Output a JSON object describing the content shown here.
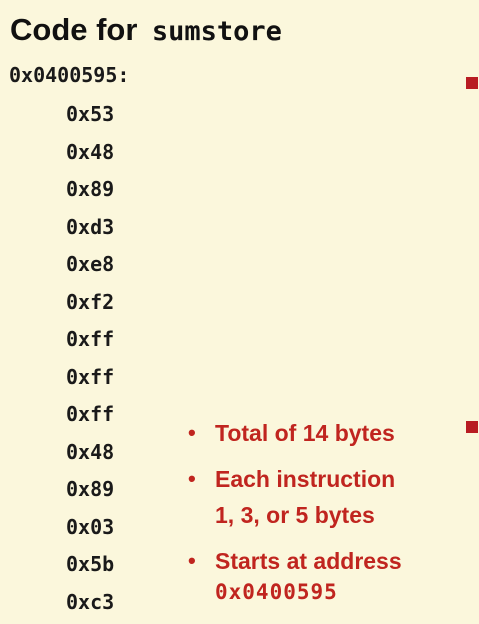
{
  "title": {
    "text": "Code for",
    "code": "sumstore"
  },
  "start_address": "0x0400595:",
  "bytes": [
    "0x53",
    "0x48",
    "0x89",
    "0xd3",
    "0xe8",
    "0xf2",
    "0xff",
    "0xff",
    "0xff",
    "0x48",
    "0x89",
    "0x03",
    "0x5b",
    "0xc3"
  ],
  "notes": {
    "total": "Total of 14 bytes",
    "instr_line1": "Each instruction",
    "instr_line2": "1, 3, or 5 bytes",
    "starts_line1": "Starts at address",
    "starts_address": "0x0400595"
  },
  "colors": {
    "background": "#fbf7dc",
    "accent": "#c0251f",
    "code_text": "#1a1a1a"
  },
  "icons": {
    "square_bullet": "red-square-bullet-icon",
    "round_bullet": "red-dot-bullet-icon"
  }
}
